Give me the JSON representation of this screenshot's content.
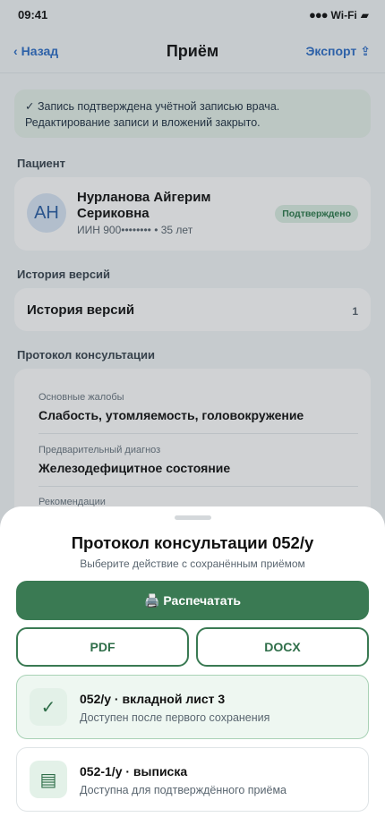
{
  "status_bar": {
    "time": "09:41",
    "signal": "●●●",
    "wifi": "Wi-Fi",
    "battery_glyph": "▰"
  },
  "nav": {
    "back_chevron": "‹",
    "back_label": "Назад",
    "title": "Приём",
    "export_label": "Экспорт",
    "export_icon": "⇪"
  },
  "notice": {
    "line1": "✓ Запись подтверждена учётной записью врача.",
    "line2": "Редактирование записи и вложений закрыто."
  },
  "patient": {
    "section_label": "Пациент",
    "initials": "АН",
    "name": "Нурланова Айгерим Сериковна",
    "meta": "ИИН 900•••••••• • 35 лет",
    "status": "Подтверждено"
  },
  "history": {
    "section_label": "История версий",
    "label": "История версий",
    "count": "1"
  },
  "protocol": {
    "section_label": "Протокол консультации",
    "fields": [
      {
        "label": "Основные жалобы",
        "value": "Слабость, утомляемость, головокружение"
      },
      {
        "label": "Предварительный диагноз",
        "value": "Железодефицитное состояние"
      },
      {
        "label": "Рекомендации",
        "value": ""
      }
    ]
  },
  "sheet": {
    "title": "Протокол консультации 052/у",
    "subtitle": "Выберите действие с сохранённым приёмом",
    "print_icon": "🖨️",
    "print_label": "Распечатать",
    "pdf_label": "PDF",
    "docx_label": "DOCX",
    "options": [
      {
        "icon": "✓",
        "title": "052/у · вкладной лист 3",
        "desc": "Доступен после первого сохранения"
      },
      {
        "icon": "▤",
        "title": "052-1/у · выписка",
        "desc": "Доступна для подтверждённого приёма"
      }
    ]
  },
  "colors": {
    "accent_green": "#3a7a53",
    "link_blue": "#2f6fc7"
  }
}
